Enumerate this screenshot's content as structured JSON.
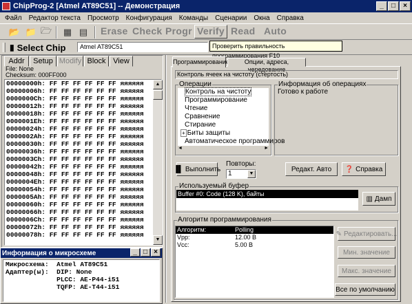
{
  "window": {
    "title": "ChipProg-2 [Atmel  AT89C51] -- Демонстрация"
  },
  "menu": [
    "Файл",
    "Редактор текста",
    "Просмотр",
    "Конфигурация",
    "Команды",
    "Сценарии",
    "Окна",
    "Справка"
  ],
  "toolbar": {
    "erase": "Erase",
    "check": "Check",
    "progr": "Progr",
    "verify": "Verify",
    "read": "Read",
    "auto": "Auto"
  },
  "select_chip": "Select Chip",
  "device": "Atmel AT89C51",
  "tooltip": "Проверить правильность программирования  F10",
  "left_tabs": [
    "Addr",
    "Setup",
    "Modify",
    "Block",
    "View"
  ],
  "file_info": {
    "file": "File: None",
    "checksum": "Checksum: 000FF000"
  },
  "hex_rows": [
    "00000000h: FF FF FF FF FF FF яяяяяя",
    "00000006h: FF FF FF FF FF FF яяяяяя",
    "0000000Ch: FF FF FF FF FF FF яяяяяя",
    "00000012h: FF FF FF FF FF FF яяяяяя",
    "00000018h: FF FF FF FF FF FF яяяяяя",
    "0000001Eh: FF FF FF FF FF FF яяяяяя",
    "00000024h: FF FF FF FF FF FF яяяяяя",
    "0000002Ah: FF FF FF FF FF FF яяяяяя",
    "00000030h: FF FF FF FF FF FF яяяяяя",
    "00000036h: FF FF FF FF FF FF яяяяяя",
    "0000003Ch: FF FF FF FF FF FF яяяяяя",
    "00000042h: FF FF FF FF FF FF яяяяяя",
    "00000048h: FF FF FF FF FF FF яяяяяя",
    "0000004Eh: FF FF FF FF FF FF яяяяяя",
    "00000054h: FF FF FF FF FF FF яяяяяя",
    "0000005Ah: FF FF FF FF FF FF яяяяяя",
    "00000060h: FF FF FF FF FF FF яяяяяя",
    "00000066h: FF FF FF FF FF FF яяяяяя",
    "0000006Ch: FF FF FF FF FF FF яяяяяя",
    "00000072h: FF FF FF FF FF FF яяяяяя",
    "00000078h: FF FF FF FF FF FF яяяяяя"
  ],
  "chip_info": {
    "title": "Информация о микросхеме",
    "lines": [
      "Микросхема:  Atmel AT89C51",
      "Адаптер(ы):  DIP: None",
      "             PLCC: AE-P44-i51",
      "             TQFP: AE-T44-i51"
    ]
  },
  "right_tabs": [
    "Программирование",
    "Опции, адреса, чередование"
  ],
  "header_status": "Контроль ячеек на чистоту (стертость)",
  "operations": {
    "label": "Операции",
    "items": [
      "Контроль на чистоту",
      "Программирование",
      "Чтение",
      "Сравнение",
      "Стирание",
      "Биты защиты",
      "Автоматическое программиров"
    ]
  },
  "op_info": {
    "label": "Информация об операциях",
    "text": "Готово к работе"
  },
  "execute": "Выполнить",
  "repeats": {
    "label": "Повторы:",
    "value": "1"
  },
  "edit_auto": "Редакт. Авто",
  "help": "Справка",
  "buffer": {
    "label": "Используемый буфер",
    "item": "Buffer #0:  Code (128 K), байты",
    "dump": "Дамп"
  },
  "algorithm": {
    "label": "Алгоритм программирования",
    "rows": [
      {
        "k": "Алгоритм:",
        "v": "Polling"
      },
      {
        "k": "Vpp:",
        "v": "12.00 В"
      },
      {
        "k": "Vcc:",
        "v": "5.00 В"
      }
    ]
  },
  "algo_buttons": {
    "edit": "Редактировать...",
    "min": "Мин. значение",
    "max": "Макс. значение",
    "defaults": "Все по умолчанию"
  }
}
